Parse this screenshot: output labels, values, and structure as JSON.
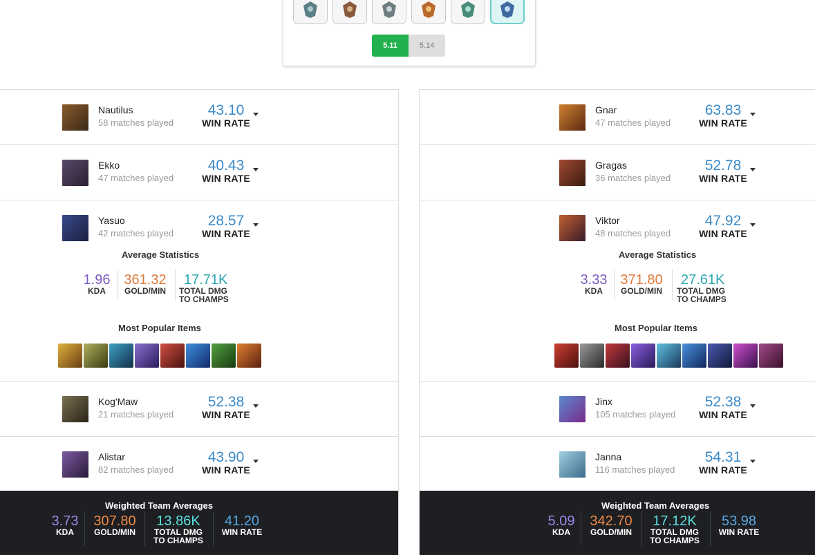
{
  "patches": {
    "active": "5.11",
    "other": "5.14"
  },
  "tiers": [
    {
      "name": "bronze-tier-icon",
      "color": "#5b7f86"
    },
    {
      "name": "silver-tier-icon",
      "color": "#8a5a3c"
    },
    {
      "name": "gold-tier-icon",
      "color": "#6e7e80"
    },
    {
      "name": "platinum-tier-icon",
      "color": "#b96a2c"
    },
    {
      "name": "diamond-tier-icon",
      "color": "#4a8a7a"
    },
    {
      "name": "master-tier-icon",
      "color": "#3e6aa0"
    }
  ],
  "labels": {
    "win_rate": "WIN RATE",
    "kda": "KDA",
    "gold_min": "GOLD/MIN",
    "dmg1": "TOTAL DMG",
    "dmg2": "TO CHAMPS",
    "avg_stats": "Average Statistics",
    "popular_items": "Most Popular Items",
    "weighted": "Weighted Team Averages"
  },
  "colors": {
    "kda": "#7b5bbf",
    "gold": "#e07a3c",
    "dmg": "#2aa8b0",
    "wr": "#3b8ac9",
    "footer_kda": "#9f86e6",
    "footer_gold": "#f08a45",
    "footer_dmg": "#5ce0e0",
    "footer_wr": "#5aa9e6"
  },
  "left": {
    "champions": [
      {
        "name": "Nautilus",
        "matches": "58 matches played",
        "win_rate": "43.10"
      },
      {
        "name": "Ekko",
        "matches": "47 matches played",
        "win_rate": "40.43"
      },
      {
        "name": "Yasuo",
        "matches": "42 matches played",
        "win_rate": "28.57",
        "stats": {
          "kda": "1.96",
          "gold": "361.32",
          "dmg": "17.71K"
        }
      },
      {
        "name": "Kog'Maw",
        "matches": "21 matches played",
        "win_rate": "52.38"
      },
      {
        "name": "Alistar",
        "matches": "82 matches played",
        "win_rate": "43.90"
      }
    ],
    "items": [
      "#c99a2e",
      "#8a8a4a",
      "#2a7aa0",
      "#5a4a9a",
      "#b03a2a",
      "#2a6ac0",
      "#3a7a3a",
      "#c06a20"
    ],
    "team": {
      "kda": "3.73",
      "gold": "307.80",
      "dmg": "13.86K",
      "wr": "41.20"
    }
  },
  "right": {
    "champions": [
      {
        "name": "Gnar",
        "matches": "47 matches played",
        "win_rate": "63.83"
      },
      {
        "name": "Gragas",
        "matches": "36 matches played",
        "win_rate": "52.78"
      },
      {
        "name": "Viktor",
        "matches": "48 matches played",
        "win_rate": "47.92",
        "stats": {
          "kda": "3.33",
          "gold": "371.80",
          "dmg": "27.61K"
        }
      },
      {
        "name": "Jinx",
        "matches": "105 matches played",
        "win_rate": "52.38"
      },
      {
        "name": "Janna",
        "matches": "116 matches played",
        "win_rate": "54.31"
      }
    ],
    "items": [
      "#b02a2a",
      "#6a6a6a",
      "#a02a2a",
      "#5a3ab0",
      "#3a9ab0",
      "#2a6ab0",
      "#2a3a80",
      "#a02aa0",
      "#8a2a6a"
    ],
    "team": {
      "kda": "5.09",
      "gold": "342.70",
      "dmg": "17.12K",
      "wr": "53.98"
    }
  },
  "portraits": {
    "left": [
      "#6a4a2a",
      "#4a3a5a",
      "#3a4a7a",
      "#5a5040",
      "#5a3a6a"
    ],
    "right": [
      "#b06a2a",
      "#8a3a2a",
      "#6a3a2a",
      "#7a4aa0",
      "#4a8aa0"
    ]
  }
}
